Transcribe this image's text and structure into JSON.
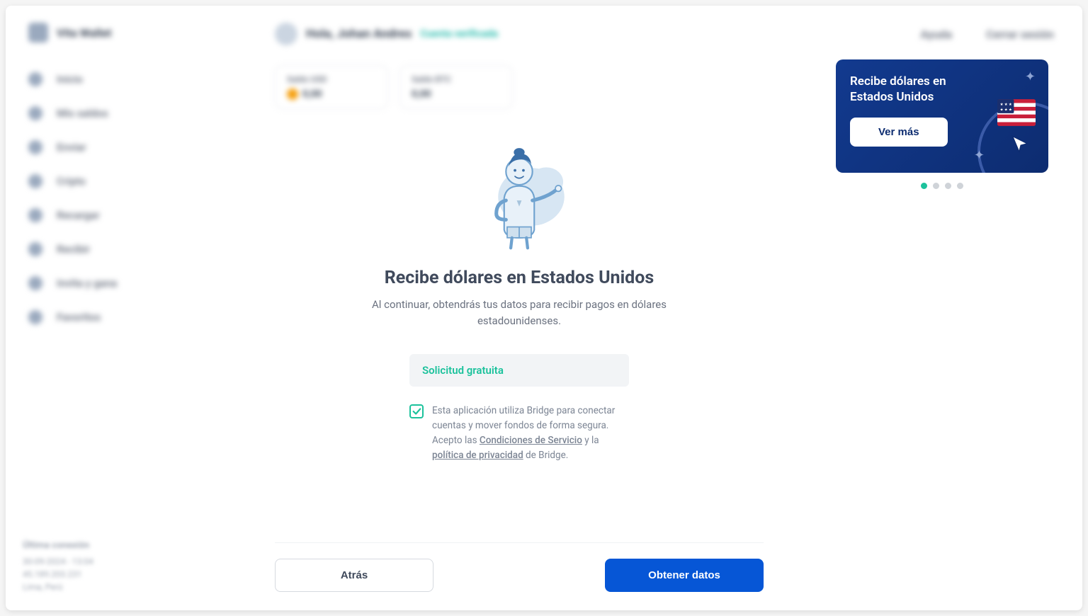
{
  "logo": {
    "text": "Vita Wallet"
  },
  "sidebar": {
    "items": [
      {
        "label": "Inicio"
      },
      {
        "label": "Mis saldos"
      },
      {
        "label": "Enviar"
      },
      {
        "label": "Cripto"
      },
      {
        "label": "Recargar"
      },
      {
        "label": "Recibir"
      },
      {
        "label": "Invita y gana"
      },
      {
        "label": "Favoritos"
      }
    ],
    "footer": {
      "title": "Última conexión",
      "line1": "30-09-2024 - 13:04",
      "line2": "45.189.203.231",
      "line3": "Lima, Perú"
    }
  },
  "header": {
    "greeting": "Hola, Johan Andres",
    "verify": "Cuenta verificada",
    "actions": {
      "help": "Ayuda",
      "logout": "Cerrar sesión"
    }
  },
  "balances": [
    {
      "label": "Saldo USD",
      "value": "0,00"
    },
    {
      "label": "Saldo BTC",
      "value": "0,00"
    }
  ],
  "promo": {
    "title": "Recibe dólares en Estados Unidos",
    "cta": "Ver más"
  },
  "main": {
    "title": "Recibe dólares en Estados Unidos",
    "subtitle": "Al continuar, obtendrás tus datos para recibir pagos en dólares estadounidenses.",
    "free_label": "Solicitud gratuita",
    "consent": {
      "line1": "Esta aplicación utiliza Bridge para conectar cuentas y mover fondos de forma segura.",
      "accept_prefix": "Acepto las ",
      "terms": "Condiciones de Servicio",
      "and": " y la ",
      "privacy": "política de privacidad",
      "suffix": " de Bridge."
    }
  },
  "actions": {
    "back": "Atrás",
    "submit": "Obtener datos"
  }
}
